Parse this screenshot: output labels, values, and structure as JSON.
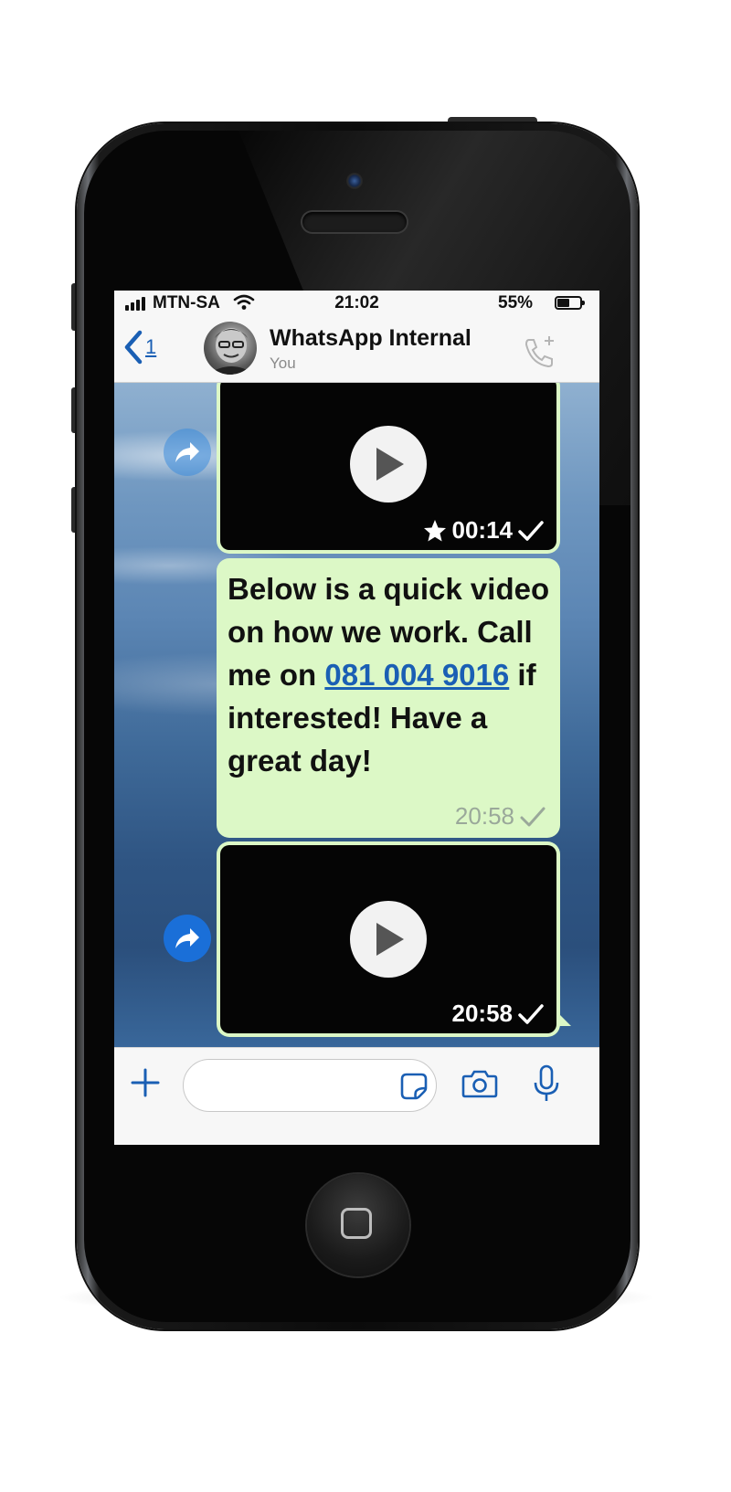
{
  "status_bar": {
    "carrier": "MTN-SA",
    "time": "21:02",
    "battery_percent": "55%",
    "battery_level": 0.55
  },
  "header": {
    "back_count": "1",
    "chat_name": "WhatsApp Internal",
    "subtitle": "You"
  },
  "messages": [
    {
      "type": "video",
      "duration": "00:14",
      "starred": true,
      "delivered": true
    },
    {
      "type": "text",
      "text_before": "Below is a quick video on how we work. Call me on ",
      "link": "081 004 9016",
      "text_after": " if interested! Have a great day!",
      "time": "20:58",
      "delivered": true
    },
    {
      "type": "video",
      "time": "20:58",
      "delivered": true
    }
  ],
  "composer": {
    "placeholder": ""
  },
  "icons": [
    "back-chevron-icon",
    "add-call-icon",
    "forward-icon",
    "play-icon",
    "star-icon",
    "check-icon",
    "plus-icon",
    "sticker-icon",
    "camera-icon",
    "microphone-icon"
  ],
  "colors": {
    "accent": "#1a5fb4",
    "outgoing_bubble": "#dcf8c6",
    "forward_button": "#1a6fd8"
  }
}
